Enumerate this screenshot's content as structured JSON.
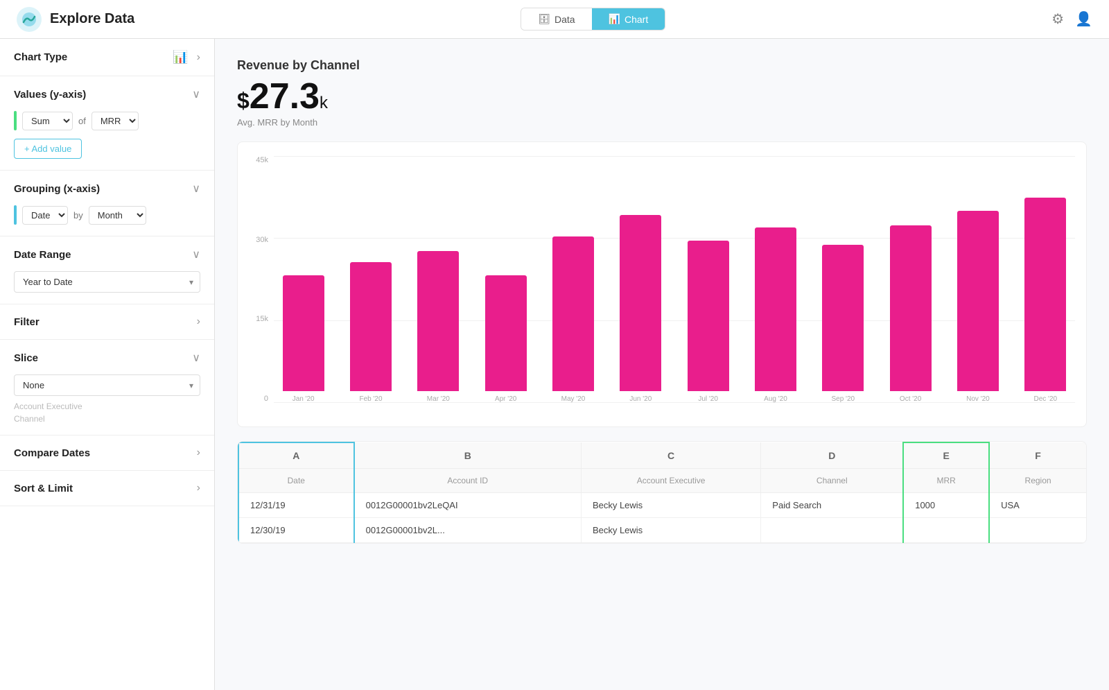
{
  "header": {
    "title": "Explore Data",
    "tabs": [
      {
        "label": "Data",
        "icon": "🗄",
        "active": false
      },
      {
        "label": "Chart",
        "icon": "📊",
        "active": true
      }
    ]
  },
  "sidebar": {
    "sections": [
      {
        "id": "chart-type",
        "title": "Chart Type",
        "toggle": "›",
        "expanded": false
      },
      {
        "id": "values",
        "title": "Values (y-axis)",
        "toggle": "∨",
        "expanded": true,
        "aggregate": "Sum",
        "of_label": "of",
        "field": "MRR",
        "add_value": "+ Add value"
      },
      {
        "id": "grouping",
        "title": "Grouping (x-axis)",
        "toggle": "∨",
        "expanded": true,
        "field": "Date",
        "by_label": "by",
        "granularity": "Month"
      },
      {
        "id": "date-range",
        "title": "Date Range",
        "toggle": "∨",
        "expanded": true,
        "value": "Year to Date"
      },
      {
        "id": "filter",
        "title": "Filter",
        "toggle": "›",
        "expanded": false
      },
      {
        "id": "slice",
        "title": "Slice",
        "toggle": "∨",
        "expanded": true,
        "value": "None",
        "options": [
          "None",
          "Account Executive",
          "Channel"
        ]
      },
      {
        "id": "compare-dates",
        "title": "Compare Dates",
        "toggle": "›",
        "expanded": false
      },
      {
        "id": "sort-limit",
        "title": "Sort & Limit",
        "toggle": "›",
        "expanded": false
      }
    ]
  },
  "chart": {
    "title": "Revenue by Channel",
    "value_prefix": "$",
    "value_main": "27.3",
    "value_suffix": "k",
    "subtitle": "Avg. MRR by Month",
    "y_labels": [
      "45k",
      "30k",
      "15k",
      "0"
    ],
    "bars": [
      {
        "label": "Jan '20",
        "height_pct": 54
      },
      {
        "label": "Feb '20",
        "height_pct": 60
      },
      {
        "label": "Mar '20",
        "height_pct": 65
      },
      {
        "label": "Apr '20",
        "height_pct": 54
      },
      {
        "label": "May '20",
        "height_pct": 72
      },
      {
        "label": "Jun '20",
        "height_pct": 82
      },
      {
        "label": "Jul '20",
        "height_pct": 70
      },
      {
        "label": "Aug '20",
        "height_pct": 76
      },
      {
        "label": "Sep '20",
        "height_pct": 68
      },
      {
        "label": "Oct '20",
        "height_pct": 77
      },
      {
        "label": "Nov '20",
        "height_pct": 84
      },
      {
        "label": "Dec '20",
        "height_pct": 90
      }
    ]
  },
  "table": {
    "col_letters": [
      "A",
      "B",
      "C",
      "D",
      "E",
      "F"
    ],
    "headers": [
      "Date",
      "Account ID",
      "Account Executive",
      "Channel",
      "MRR",
      "Region"
    ],
    "rows": [
      [
        "12/31/19",
        "0012G00001bv2LeQAI",
        "Becky Lewis",
        "Paid Search",
        "1000",
        "USA"
      ],
      [
        "12/30/19",
        "0012G00001bv2L...",
        "Becky Lewis",
        "",
        "",
        ""
      ]
    ]
  }
}
